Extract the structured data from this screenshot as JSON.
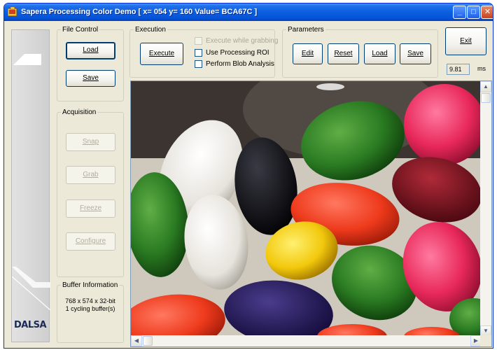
{
  "window": {
    "title": "Sapera Processing Color Demo  [ x= 054 y= 160 Value= BCA67C ]",
    "controls": {
      "minimize": "_",
      "maximize": "□",
      "close": "✕"
    }
  },
  "sidebar": {
    "logo_text": "DALSA"
  },
  "file_control": {
    "legend": "File Control",
    "load_label": "Load",
    "save_label": "Save"
  },
  "acquisition": {
    "legend": "Acquisition",
    "snap_label": "Snap",
    "grab_label": "Grab",
    "freeze_label": "Freeze",
    "configure_label": "Configure"
  },
  "buffer_info": {
    "legend": "Buffer Information",
    "line1": "768 x 574 x 32-bit",
    "line2": "1 cycling buffer(s)"
  },
  "execution": {
    "legend": "Execution",
    "execute_label": "Execute",
    "checkboxes": [
      {
        "label": "Execute while grabbing",
        "checked": false,
        "enabled": false
      },
      {
        "label": "Use Processing ROI",
        "checked": false,
        "enabled": true
      },
      {
        "label": "Perform Blob Analysis",
        "checked": false,
        "enabled": true
      }
    ]
  },
  "parameters": {
    "legend": "Parameters",
    "edit_label": "Edit",
    "reset_label": "Reset",
    "load_label": "Load",
    "save_label": "Save"
  },
  "exit_label": "Exit",
  "timing": {
    "value": "9.81",
    "unit": "ms"
  },
  "scrollbars": {
    "up": "▲",
    "down": "▼",
    "left": "◀",
    "right": "▶"
  },
  "colors": {
    "titlebar": "#0a5fe0",
    "window_bg": "#ece9d8",
    "button_border": "#003c74",
    "logo": "#1a2a57"
  }
}
